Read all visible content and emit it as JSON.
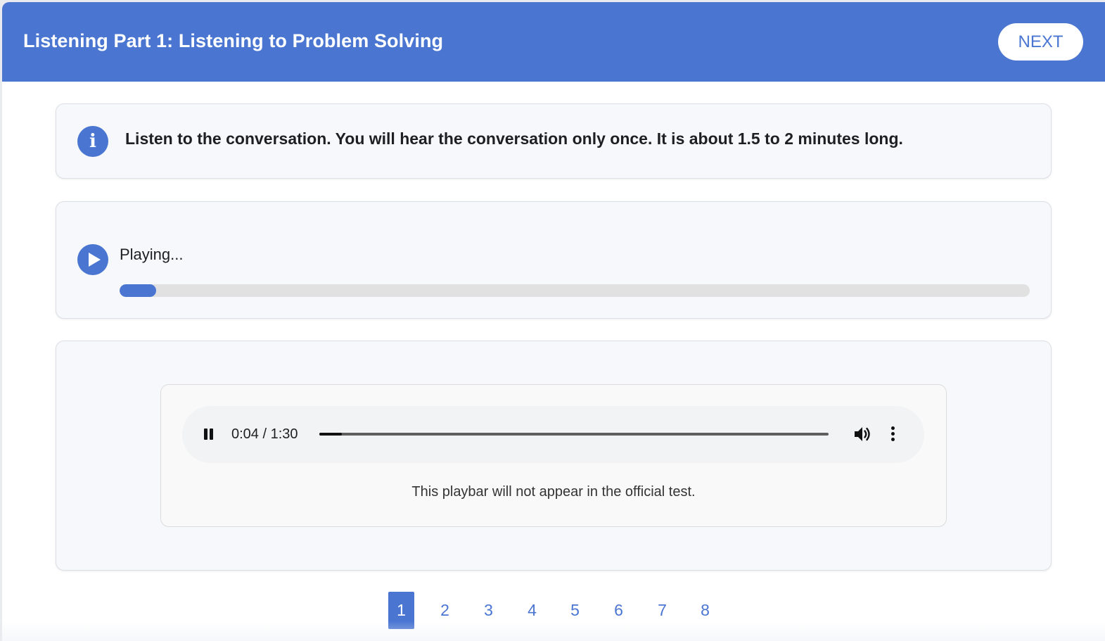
{
  "header": {
    "title": "Listening Part 1: Listening to Problem Solving",
    "next_label": "NEXT"
  },
  "instruction": {
    "icon": "info-icon",
    "text": "Listen to the conversation. You will hear the conversation only once. It is about 1.5 to 2 minutes long."
  },
  "playback_status": {
    "icon": "play-circle-icon",
    "label": "Playing...",
    "progress_fraction": 0.04
  },
  "audio_player": {
    "pause_icon": "pause-icon",
    "current_time": "0:04",
    "duration": "1:30",
    "time_display": "0:04 / 1:30",
    "volume_icon": "volume-icon",
    "more_icon": "more-options-icon",
    "disclaimer": "This playbar will not appear in the official test."
  },
  "pagination": {
    "pages": [
      "1",
      "2",
      "3",
      "4",
      "5",
      "6",
      "7",
      "8"
    ],
    "active_index": 0
  },
  "colors": {
    "accent": "#4a76d2",
    "card_bg": "#f7f8fb",
    "track": "#e1e1e1"
  }
}
